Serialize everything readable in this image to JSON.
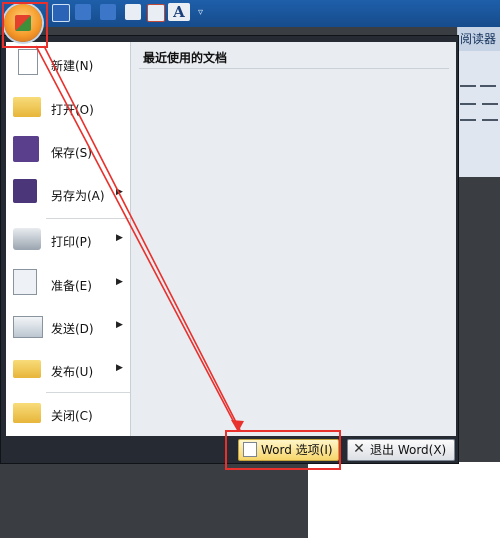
{
  "ribbon": {
    "tab_text": "阅读器"
  },
  "office_menu": {
    "recent_title": "最近使用的文档",
    "items": [
      {
        "label": "新建(N)",
        "has_arrow": false
      },
      {
        "label": "打开(O)",
        "has_arrow": false
      },
      {
        "label": "保存(S)",
        "has_arrow": false
      },
      {
        "label": "另存为(A)",
        "has_arrow": true
      },
      {
        "label": "打印(P)",
        "has_arrow": true
      },
      {
        "label": "准备(E)",
        "has_arrow": true
      },
      {
        "label": "发送(D)",
        "has_arrow": true
      },
      {
        "label": "发布(U)",
        "has_arrow": true
      },
      {
        "label": "关闭(C)",
        "has_arrow": false
      }
    ],
    "arrow_glyph": "▶",
    "word_options_label": "Word 选项(I)",
    "exit_word_label": "退出 Word(X)"
  },
  "quick_access": {
    "more_glyph": "▿",
    "font_glyph": "A"
  },
  "colors": {
    "annotation_red": "#e8302c",
    "title_bar": "#1e5faa",
    "menu_frame": "#252a33"
  }
}
